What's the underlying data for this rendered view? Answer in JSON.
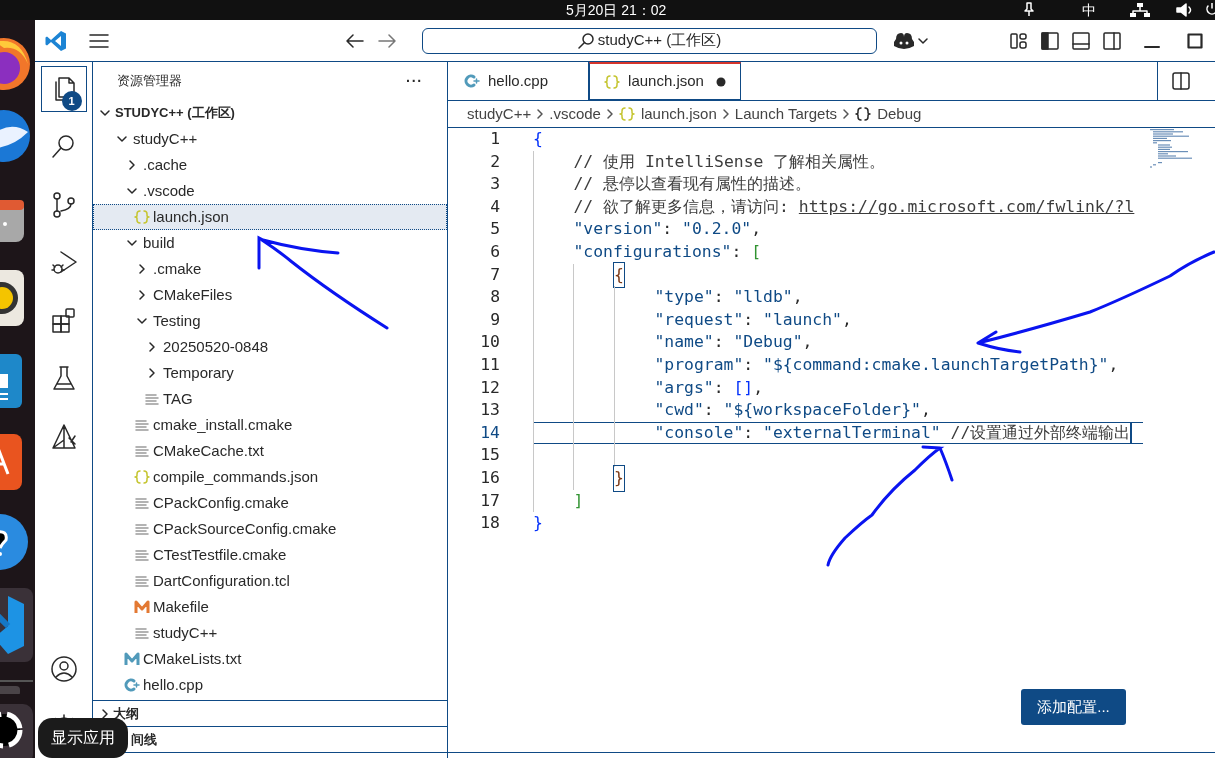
{
  "topbar": {
    "clock": "5月20日 21：02",
    "input_method": "中"
  },
  "titlebar": {
    "command_center": "studyC++ (工作区)"
  },
  "activity_bar": [
    {
      "kind": "explorer",
      "selected": true,
      "badge": "1"
    },
    {
      "kind": "search",
      "selected": false
    },
    {
      "kind": "source-control",
      "selected": false
    },
    {
      "kind": "run-debug",
      "selected": false
    },
    {
      "kind": "extensions",
      "selected": false
    },
    {
      "kind": "testing",
      "selected": false
    },
    {
      "kind": "cmake",
      "selected": false
    },
    {
      "kind": "account",
      "selected": false
    },
    {
      "kind": "settings",
      "selected": false
    }
  ],
  "sidebar": {
    "title": "资源管理器",
    "more": "···",
    "workspace": {
      "label": "STUDYC++ (工作区)",
      "expanded": true
    },
    "tree": [
      {
        "label": "studyC++",
        "kind": "folder",
        "expanded": true,
        "selected": false,
        "children": [
          {
            "label": ".cache",
            "kind": "folder",
            "expanded": false,
            "selected": false
          },
          {
            "label": ".vscode",
            "kind": "folder",
            "expanded": true,
            "selected": false,
            "children": [
              {
                "label": "launch.json",
                "kind": "json",
                "selected": true
              }
            ]
          },
          {
            "label": "build",
            "kind": "folder",
            "expanded": true,
            "selected": false,
            "children": [
              {
                "label": ".cmake",
                "kind": "folder",
                "expanded": false,
                "selected": false
              },
              {
                "label": "CMakeFiles",
                "kind": "folder",
                "expanded": false,
                "selected": false
              },
              {
                "label": "Testing",
                "kind": "folder",
                "expanded": true,
                "selected": false,
                "children": [
                  {
                    "label": "20250520-0848",
                    "kind": "folder",
                    "expanded": false,
                    "selected": false
                  },
                  {
                    "label": "Temporary",
                    "kind": "folder",
                    "expanded": false,
                    "selected": false
                  },
                  {
                    "label": "TAG",
                    "kind": "plain",
                    "selected": false
                  }
                ]
              },
              {
                "label": "cmake_install.cmake",
                "kind": "plain",
                "selected": false
              },
              {
                "label": "CMakeCache.txt",
                "kind": "plain",
                "selected": false
              },
              {
                "label": "compile_commands.json",
                "kind": "json",
                "selected": false
              },
              {
                "label": "CPackConfig.cmake",
                "kind": "plain",
                "selected": false
              },
              {
                "label": "CPackSourceConfig.cmake",
                "kind": "plain",
                "selected": false
              },
              {
                "label": "CTestTestfile.cmake",
                "kind": "plain",
                "selected": false
              },
              {
                "label": "DartConfiguration.tcl",
                "kind": "plain",
                "selected": false
              },
              {
                "label": "Makefile",
                "kind": "makefile",
                "selected": false
              },
              {
                "label": "studyC++",
                "kind": "plain",
                "selected": false
              }
            ]
          },
          {
            "label": "CMakeLists.txt",
            "kind": "cmake",
            "selected": false
          },
          {
            "label": "hello.cpp",
            "kind": "cpp",
            "selected": false
          }
        ]
      }
    ],
    "panels": [
      {
        "title": "大纲",
        "expanded": false
      },
      {
        "title": "间线"
      }
    ]
  },
  "editor": {
    "tabs": [
      {
        "label": "hello.cpp",
        "kind": "cpp",
        "selected": false,
        "modified": false
      },
      {
        "label": "launch.json",
        "kind": "json",
        "selected": true,
        "modified": true
      }
    ],
    "breadcrumbs": [
      {
        "label": "studyC++",
        "kind": "plain"
      },
      {
        "label": ".vscode",
        "kind": "plain"
      },
      {
        "label": "launch.json",
        "kind": "json"
      },
      {
        "label": "Launch Targets",
        "kind": "plain"
      },
      {
        "label": "Debug",
        "kind": "object"
      }
    ],
    "lines": [
      {
        "number": "1",
        "current": false,
        "tokens": [
          {
            "text": "{",
            "kind": "bracket-1"
          }
        ]
      },
      {
        "number": "2",
        "current": false,
        "tokens": [
          {
            "text": "    // 使用 IntelliSense 了解相关属性。",
            "kind": "comment"
          }
        ]
      },
      {
        "number": "3",
        "current": false,
        "tokens": [
          {
            "text": "    // 悬停以查看现有属性的描述。",
            "kind": "comment"
          }
        ]
      },
      {
        "number": "4",
        "current": false,
        "tokens": [
          {
            "text": "    // 欲了解更多信息，请访问: ",
            "kind": "comment"
          },
          {
            "text": "https://go.microsoft.com/fwlink/?l",
            "kind": "link"
          }
        ]
      },
      {
        "number": "5",
        "current": false,
        "tokens": [
          {
            "text": "    \"version\"",
            "kind": "key"
          },
          {
            "text": ": ",
            "kind": "punct"
          },
          {
            "text": "\"0.2.0\"",
            "kind": "string"
          },
          {
            "text": ",",
            "kind": "punct"
          }
        ]
      },
      {
        "number": "6",
        "current": false,
        "tokens": [
          {
            "text": "    \"configurations\"",
            "kind": "key"
          },
          {
            "text": ": ",
            "kind": "punct"
          },
          {
            "text": "[",
            "kind": "bracket-2"
          }
        ]
      },
      {
        "number": "7",
        "current": false,
        "tokens": [
          {
            "text": "        {",
            "kind": "bracket-match"
          }
        ]
      },
      {
        "number": "8",
        "current": false,
        "tokens": [
          {
            "text": "            \"type\"",
            "kind": "key"
          },
          {
            "text": ": ",
            "kind": "punct"
          },
          {
            "text": "\"lldb\"",
            "kind": "string"
          },
          {
            "text": ",",
            "kind": "punct"
          }
        ]
      },
      {
        "number": "9",
        "current": false,
        "tokens": [
          {
            "text": "            \"request\"",
            "kind": "key"
          },
          {
            "text": ": ",
            "kind": "punct"
          },
          {
            "text": "\"launch\"",
            "kind": "string"
          },
          {
            "text": ",",
            "kind": "punct"
          }
        ]
      },
      {
        "number": "10",
        "current": false,
        "tokens": [
          {
            "text": "            \"name\"",
            "kind": "key"
          },
          {
            "text": ": ",
            "kind": "punct"
          },
          {
            "text": "\"Debug\"",
            "kind": "string"
          },
          {
            "text": ",",
            "kind": "punct"
          }
        ]
      },
      {
        "number": "11",
        "current": false,
        "tokens": [
          {
            "text": "            \"program\"",
            "kind": "key"
          },
          {
            "text": ": ",
            "kind": "punct"
          },
          {
            "text": "\"${command:cmake.launchTargetPath}\"",
            "kind": "string"
          },
          {
            "text": ",",
            "kind": "punct"
          }
        ]
      },
      {
        "number": "12",
        "current": false,
        "tokens": [
          {
            "text": "            \"args\"",
            "kind": "key"
          },
          {
            "text": ": ",
            "kind": "punct"
          },
          {
            "text": "[]",
            "kind": "bracket-1"
          },
          {
            "text": ",",
            "kind": "punct"
          }
        ]
      },
      {
        "number": "13",
        "current": false,
        "tokens": [
          {
            "text": "            \"cwd\"",
            "kind": "key"
          },
          {
            "text": ": ",
            "kind": "punct"
          },
          {
            "text": "\"${workspaceFolder}\"",
            "kind": "string"
          },
          {
            "text": ",",
            "kind": "punct"
          }
        ]
      },
      {
        "number": "14",
        "current": true,
        "tokens": [
          {
            "text": "            \"console\"",
            "kind": "key"
          },
          {
            "text": ": ",
            "kind": "punct"
          },
          {
            "text": "\"externalTerminal\"",
            "kind": "string"
          },
          {
            "text": " //设置通过外部终端输出",
            "kind": "comment"
          }
        ]
      },
      {
        "number": "15",
        "current": false
      },
      {
        "number": "16",
        "current": false,
        "tokens": [
          {
            "text": "        }",
            "kind": "bracket-match"
          }
        ]
      },
      {
        "number": "17",
        "current": false,
        "tokens": [
          {
            "text": "    ]",
            "kind": "bracket-2"
          }
        ]
      },
      {
        "number": "18",
        "current": false,
        "tokens": [
          {
            "text": "}",
            "kind": "bracket-1"
          }
        ]
      }
    ],
    "add_button": "添加配置..."
  },
  "tooltip": "显示应用"
}
